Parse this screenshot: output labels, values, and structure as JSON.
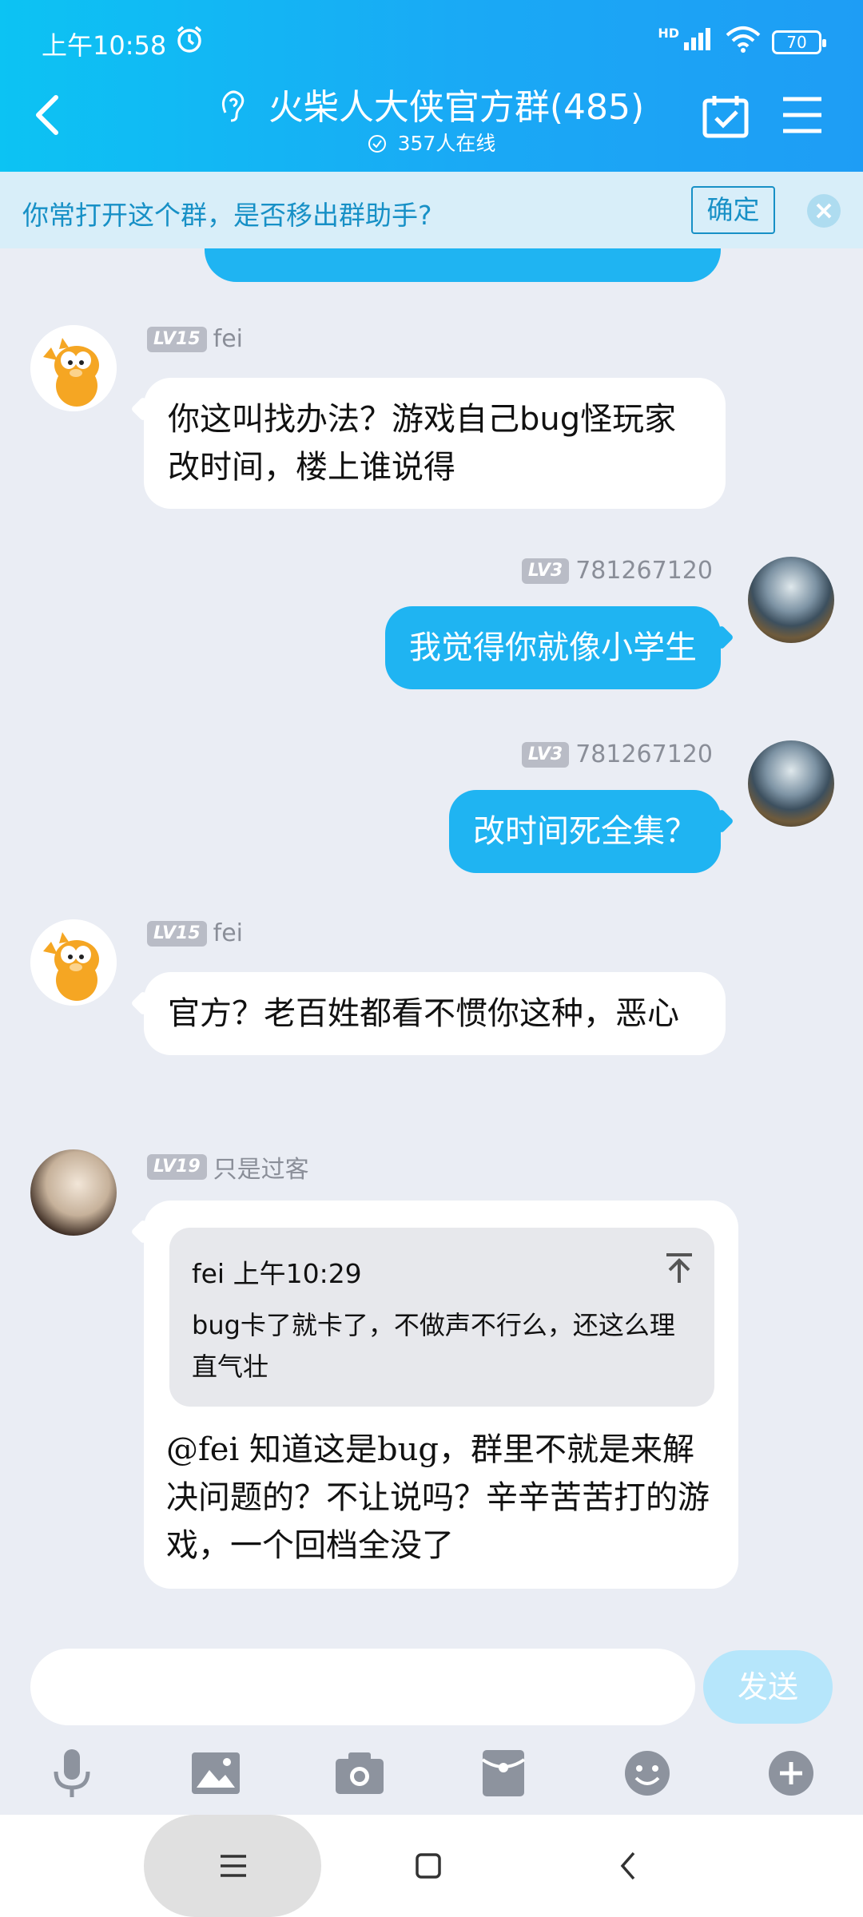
{
  "status_bar": {
    "time": "上午10:58",
    "network": "HD",
    "battery": "70"
  },
  "header": {
    "title": "火柴人大侠官方群(485)",
    "online": "357人在线"
  },
  "notice": {
    "text": "你常打开这个群，是否移出群助手?",
    "confirm": "确定"
  },
  "messages": [
    {
      "level": "LV15",
      "name": "fei",
      "text": "你这叫找办法？游戏自己bug怪玩家改时间，楼上谁说得"
    },
    {
      "level": "LV3",
      "name": "781267120",
      "text": "我觉得你就像小学生"
    },
    {
      "level": "LV3",
      "name": "781267120",
      "text": "改时间死全集？"
    },
    {
      "level": "LV15",
      "name": "fei",
      "text": "官方？老百姓都看不惯你这种，恶心"
    },
    {
      "level": "LV19",
      "name": "只是过客",
      "quote_header": "fei 上午10:29",
      "quote_text": "bug卡了就卡了，不做声不行么，还这么理直气壮",
      "text": "@fei 知道这是bug，群里不就是来解决问题的？不让说吗？辛辛苦苦打的游戏，一个回档全没了"
    }
  ],
  "input": {
    "send": "发送"
  },
  "toolbar_icons": [
    "microphone-icon",
    "image-icon",
    "camera-icon",
    "red-packet-icon",
    "emoji-icon",
    "plus-icon"
  ]
}
